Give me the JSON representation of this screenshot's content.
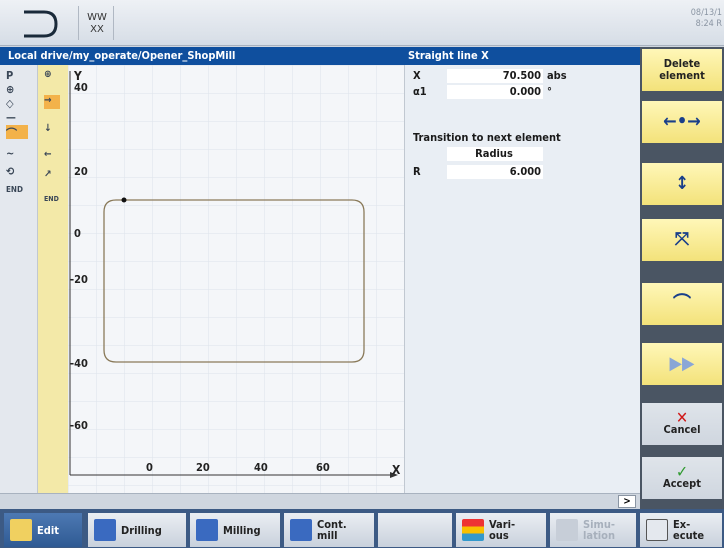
{
  "header": {
    "datetime_line1": "08/13/1",
    "datetime_line2": "8:24 R"
  },
  "path": "Local drive/my_operate/Opener_ShopMill",
  "panel_title": "Straight line X",
  "left_sidebar": [
    "P",
    "⊕",
    "◇",
    "—",
    "⌒",
    "~",
    "⟲",
    "END"
  ],
  "left_sidebar2": [
    "⊕",
    "→",
    "↓",
    "←",
    "↗",
    "END"
  ],
  "graphic": {
    "y_axis_label": "Y",
    "x_axis_label": "X",
    "y_ticks": [
      "40",
      "20",
      "0",
      "-20",
      "-40",
      "-60"
    ],
    "x_ticks": [
      "0",
      "20",
      "40",
      "60"
    ]
  },
  "params": {
    "x_label": "X",
    "x_value": "70.500",
    "x_unit": "abs",
    "a1_label": "α1",
    "a1_value": "0.000",
    "a1_unit": "°",
    "transition_label": "Transition to next element",
    "transition_type": "Radius",
    "r_label": "R",
    "r_value": "6.000"
  },
  "softkeys": {
    "delete_element": "Delete element",
    "horizontal_icon": "horizontal-line-icon",
    "vertical_icon": "vertical-line-icon",
    "diagonal_icon": "diagonal-line-icon",
    "arc_icon": "arc-icon",
    "forward_icon": "fast-forward-icon",
    "cancel": "Cancel",
    "accept": "Accept"
  },
  "expand_label": ">",
  "bottom_keys": {
    "edit": "Edit",
    "drilling": "Drilling",
    "milling": "Milling",
    "cont_mill": "Cont. mill",
    "various": "Vari-ous",
    "simulation": "Simu-lation",
    "execute": "Ex-ecute"
  },
  "colors": {
    "title_blue": "#0f4f9e",
    "softkey_yellow": "#f3e27a",
    "active_orange": "#f3b24a"
  }
}
